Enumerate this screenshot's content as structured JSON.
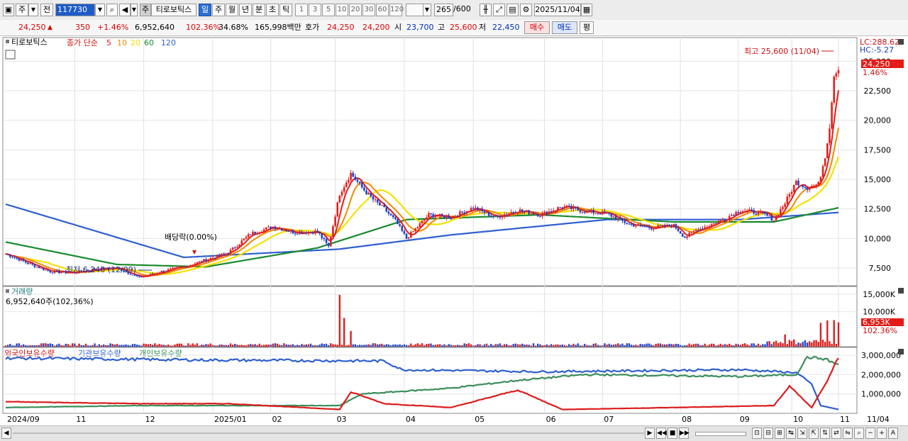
{
  "toolbar": {
    "period_label": "주",
    "prev_label": "전",
    "code": "117730",
    "name_badge": "주",
    "name": "티로보틱스",
    "periods": [
      "일",
      "주",
      "월",
      "년",
      "분",
      "초",
      "틱"
    ],
    "active_period": "일",
    "intervals": [
      "1",
      "3",
      "5",
      "10",
      "20",
      "30",
      "60",
      "120"
    ],
    "count": "265",
    "count_max": "/600",
    "date": "2025/11/04"
  },
  "quote": {
    "price": "24,250",
    "change": "350",
    "change_pct": "+1.46%",
    "volume": "6,952,640",
    "vol_ratio": "102.36%",
    "turnover": "34.68%",
    "amount": "165,998백만",
    "hoga_label": "호가",
    "ask": "24,250",
    "bid": "24,200",
    "open_label": "시",
    "open": "23,700",
    "high_label": "고",
    "high": "25,600",
    "low_label": "저",
    "low": "22,450",
    "buy_label": "매수",
    "sell_label": "매도",
    "avg_label": "평"
  },
  "chart_data": [
    {
      "type": "candlestick",
      "title": "티로보틱스",
      "legend": [
        "종가 단순",
        "5",
        "10",
        "20",
        "60",
        "120"
      ],
      "series_colors": {
        "5": "#e41b17",
        "10": "#f08a00",
        "20": "#f2e200",
        "60": "#1a8a2e",
        "120": "#2e5fd0"
      },
      "ylim": [
        6000,
        27000
      ],
      "yticks": [
        "7,500",
        "10,000",
        "12,500",
        "15,000",
        "17,500",
        "20,000",
        "22,500",
        "25,000"
      ],
      "last_price": "24,250",
      "last_change": "1.46%",
      "lc_label": "LC:288.62",
      "hc_label": "HC:-5.27",
      "high_annotation": "최고 25,600 (11/04)",
      "low_annotation": "최저 6,240 (12/09)",
      "dividend_annotation": "배당락(0.00%)",
      "x_labels": [
        "2024/09",
        "11",
        "12",
        "2025/01",
        "02",
        "03",
        "04",
        "05",
        "06",
        "07",
        "08",
        "09",
        "10",
        "11",
        "11/04"
      ],
      "keypoints": [
        {
          "t": 0,
          "v": 8700
        },
        {
          "t": 10,
          "v": 7900
        },
        {
          "t": 20,
          "v": 7200
        },
        {
          "t": 30,
          "v": 7100
        },
        {
          "t": 40,
          "v": 7400
        },
        {
          "t": 50,
          "v": 7500
        },
        {
          "t": 60,
          "v": 6700
        },
        {
          "t": 70,
          "v": 7200
        },
        {
          "t": 80,
          "v": 7600
        },
        {
          "t": 90,
          "v": 8200
        },
        {
          "t": 100,
          "v": 8800
        },
        {
          "t": 110,
          "v": 10400
        },
        {
          "t": 120,
          "v": 11000
        },
        {
          "t": 130,
          "v": 10500
        },
        {
          "t": 140,
          "v": 10600
        },
        {
          "t": 145,
          "v": 9300
        },
        {
          "t": 150,
          "v": 13800
        },
        {
          "t": 155,
          "v": 15500
        },
        {
          "t": 160,
          "v": 14300
        },
        {
          "t": 165,
          "v": 13300
        },
        {
          "t": 170,
          "v": 12500
        },
        {
          "t": 175,
          "v": 11500
        },
        {
          "t": 180,
          "v": 10000
        },
        {
          "t": 185,
          "v": 11000
        },
        {
          "t": 190,
          "v": 12000
        },
        {
          "t": 200,
          "v": 11800
        },
        {
          "t": 210,
          "v": 12600
        },
        {
          "t": 220,
          "v": 11800
        },
        {
          "t": 230,
          "v": 12400
        },
        {
          "t": 240,
          "v": 12000
        },
        {
          "t": 250,
          "v": 12700
        },
        {
          "t": 260,
          "v": 12300
        },
        {
          "t": 270,
          "v": 12100
        },
        {
          "t": 280,
          "v": 11200
        },
        {
          "t": 290,
          "v": 10900
        },
        {
          "t": 300,
          "v": 11100
        },
        {
          "t": 305,
          "v": 10100
        },
        {
          "t": 310,
          "v": 10700
        },
        {
          "t": 320,
          "v": 11400
        },
        {
          "t": 330,
          "v": 12400
        },
        {
          "t": 340,
          "v": 12100
        },
        {
          "t": 345,
          "v": 11600
        },
        {
          "t": 350,
          "v": 13000
        },
        {
          "t": 355,
          "v": 14800
        },
        {
          "t": 360,
          "v": 14300
        },
        {
          "t": 365,
          "v": 14600
        },
        {
          "t": 368,
          "v": 17000
        },
        {
          "t": 370,
          "v": 19500
        },
        {
          "t": 372,
          "v": 23700
        },
        {
          "t": 374,
          "v": 24250
        }
      ],
      "moving_averages": [
        {
          "name": "120",
          "points": [
            {
              "t": 0,
              "v": 12900
            },
            {
              "t": 80,
              "v": 8400
            },
            {
              "t": 150,
              "v": 9100
            },
            {
              "t": 200,
              "v": 10300
            },
            {
              "t": 270,
              "v": 11600
            },
            {
              "t": 330,
              "v": 11600
            },
            {
              "t": 374,
              "v": 12200
            }
          ]
        },
        {
          "name": "60",
          "points": [
            {
              "t": 0,
              "v": 9700
            },
            {
              "t": 50,
              "v": 7800
            },
            {
              "t": 90,
              "v": 7600
            },
            {
              "t": 140,
              "v": 9200
            },
            {
              "t": 180,
              "v": 11600
            },
            {
              "t": 240,
              "v": 12000
            },
            {
              "t": 300,
              "v": 11400
            },
            {
              "t": 345,
              "v": 11400
            },
            {
              "t": 374,
              "v": 12600
            }
          ]
        }
      ]
    },
    {
      "type": "bar",
      "title": "거래량",
      "summary": "6,952,640주(102,36%)",
      "ylim": [
        0,
        16000
      ],
      "yticks": [
        "15,000K",
        "10,000K"
      ],
      "last_value": "6,953K",
      "last_pct": "102.36%",
      "spikes_k": [
        {
          "t": 150,
          "v": 14800
        },
        {
          "t": 152,
          "v": 8200
        },
        {
          "t": 155,
          "v": 4500
        },
        {
          "t": 350,
          "v": 3500
        },
        {
          "t": 366,
          "v": 6800
        },
        {
          "t": 369,
          "v": 7500
        },
        {
          "t": 372,
          "v": 7600
        },
        {
          "t": 374,
          "v": 6953
        }
      ]
    },
    {
      "type": "line",
      "title": "외국인보유수량",
      "legend": [
        "외국인보유수량",
        "기관보유수량",
        "개인보유수량"
      ],
      "yticks": [
        "3,000,000",
        "2,000,000",
        "1,000,000"
      ],
      "ylim": [
        0,
        3400000
      ],
      "series": [
        {
          "name": "기관보유수량",
          "color": "#2e5fd0",
          "points": [
            {
              "t": 0,
              "v": 2850000
            },
            {
              "t": 90,
              "v": 2750000
            },
            {
              "t": 170,
              "v": 2700000
            },
            {
              "t": 178,
              "v": 2250000
            },
            {
              "t": 240,
              "v": 2150000
            },
            {
              "t": 330,
              "v": 2250000
            },
            {
              "t": 355,
              "v": 2100000
            },
            {
              "t": 362,
              "v": 1500000
            },
            {
              "t": 366,
              "v": 400000
            },
            {
              "t": 374,
              "v": 200000
            }
          ]
        },
        {
          "name": "개인보유수량",
          "color": "#3a8e5a",
          "points": [
            {
              "t": 0,
              "v": 300000
            },
            {
              "t": 60,
              "v": 400000
            },
            {
              "t": 150,
              "v": 400000
            },
            {
              "t": 160,
              "v": 1000000
            },
            {
              "t": 200,
              "v": 1300000
            },
            {
              "t": 230,
              "v": 1700000
            },
            {
              "t": 260,
              "v": 2000000
            },
            {
              "t": 330,
              "v": 1900000
            },
            {
              "t": 355,
              "v": 2000000
            },
            {
              "t": 360,
              "v": 2900000
            },
            {
              "t": 368,
              "v": 2800000
            },
            {
              "t": 374,
              "v": 2500000
            }
          ]
        },
        {
          "name": "외국인보유수량",
          "color": "#dd1c1c",
          "points": [
            {
              "t": 0,
              "v": 600000
            },
            {
              "t": 60,
              "v": 500000
            },
            {
              "t": 100,
              "v": 500000
            },
            {
              "t": 150,
              "v": 200000
            },
            {
              "t": 155,
              "v": 1100000
            },
            {
              "t": 170,
              "v": 500000
            },
            {
              "t": 200,
              "v": 300000
            },
            {
              "t": 230,
              "v": 1200000
            },
            {
              "t": 250,
              "v": 200000
            },
            {
              "t": 300,
              "v": 300000
            },
            {
              "t": 345,
              "v": 400000
            },
            {
              "t": 352,
              "v": 1400000
            },
            {
              "t": 362,
              "v": 300000
            },
            {
              "t": 370,
              "v": 1900000
            },
            {
              "t": 374,
              "v": 2900000
            }
          ]
        }
      ]
    }
  ],
  "scroll": {
    "zoom_label": "A"
  }
}
